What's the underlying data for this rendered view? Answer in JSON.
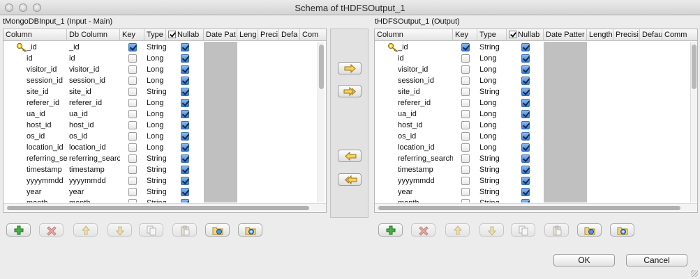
{
  "window": {
    "title": "Schema of tHDFSOutput_1"
  },
  "left": {
    "label": "tMongoDBInput_1 (Input - Main)",
    "headers": [
      "Column",
      "Db Column",
      "Key",
      "Type",
      "Nullab",
      "Date Pat",
      "Leng",
      "Preci",
      "Defa",
      "Com"
    ],
    "rows": [
      {
        "column": "_id",
        "db": "_id",
        "key": true,
        "type": "String",
        "nullable": true
      },
      {
        "column": "id",
        "db": "id",
        "key": false,
        "type": "Long",
        "nullable": true
      },
      {
        "column": "visitor_id",
        "db": "visitor_id",
        "key": false,
        "type": "Long",
        "nullable": true
      },
      {
        "column": "session_id",
        "db": "session_id",
        "key": false,
        "type": "Long",
        "nullable": true
      },
      {
        "column": "site_id",
        "db": "site_id",
        "key": false,
        "type": "String",
        "nullable": true
      },
      {
        "column": "referer_id",
        "db": "referer_id",
        "key": false,
        "type": "Long",
        "nullable": true
      },
      {
        "column": "ua_id",
        "db": "ua_id",
        "key": false,
        "type": "Long",
        "nullable": true
      },
      {
        "column": "host_id",
        "db": "host_id",
        "key": false,
        "type": "Long",
        "nullable": true
      },
      {
        "column": "os_id",
        "db": "os_id",
        "key": false,
        "type": "Long",
        "nullable": true
      },
      {
        "column": "location_id",
        "db": "location_id",
        "key": false,
        "type": "Long",
        "nullable": true
      },
      {
        "column": "referring_search",
        "db": "referring_search",
        "key": false,
        "type": "String",
        "nullable": true
      },
      {
        "column": "timestamp",
        "db": "timestamp",
        "key": false,
        "type": "String",
        "nullable": true
      },
      {
        "column": "yyyymmdd",
        "db": "yyyymmdd",
        "key": false,
        "type": "String",
        "nullable": true
      },
      {
        "column": "year",
        "db": "year",
        "key": false,
        "type": "String",
        "nullable": true
      },
      {
        "column": "month",
        "db": "month",
        "key": false,
        "type": "String",
        "nullable": true
      }
    ]
  },
  "right": {
    "label": "tHDFSOutput_1 (Output)",
    "headers": [
      "Column",
      "Key",
      "Type",
      "Nullab",
      "Date Patter",
      "Length",
      "Precisi",
      "Defau",
      "Comm"
    ],
    "rows": [
      {
        "column": "_id",
        "key": true,
        "type": "String",
        "nullable": true
      },
      {
        "column": "id",
        "key": false,
        "type": "Long",
        "nullable": true
      },
      {
        "column": "visitor_id",
        "key": false,
        "type": "Long",
        "nullable": true
      },
      {
        "column": "session_id",
        "key": false,
        "type": "Long",
        "nullable": true
      },
      {
        "column": "site_id",
        "key": false,
        "type": "String",
        "nullable": true
      },
      {
        "column": "referer_id",
        "key": false,
        "type": "Long",
        "nullable": true
      },
      {
        "column": "ua_id",
        "key": false,
        "type": "Long",
        "nullable": true
      },
      {
        "column": "host_id",
        "key": false,
        "type": "Long",
        "nullable": true
      },
      {
        "column": "os_id",
        "key": false,
        "type": "Long",
        "nullable": true
      },
      {
        "column": "location_id",
        "key": false,
        "type": "Long",
        "nullable": true
      },
      {
        "column": "referring_search",
        "key": false,
        "type": "String",
        "nullable": true
      },
      {
        "column": "timestamp",
        "key": false,
        "type": "String",
        "nullable": true
      },
      {
        "column": "yyyymmdd",
        "key": false,
        "type": "String",
        "nullable": true
      },
      {
        "column": "year",
        "key": false,
        "type": "String",
        "nullable": true
      },
      {
        "column": "month",
        "key": false,
        "type": "String",
        "nullable": true
      }
    ]
  },
  "transfer_buttons": [
    "copy-selected-right-icon",
    "copy-all-right-icon",
    "copy-selected-left-icon",
    "copy-all-left-icon"
  ],
  "toolbar_icons": [
    "add-icon",
    "remove-icon",
    "move-up-icon",
    "move-down-icon",
    "copy-icon",
    "paste-icon",
    "import-icon",
    "export-icon"
  ],
  "buttons": {
    "ok": "OK",
    "cancel": "Cancel"
  },
  "colors": {
    "check_blue": "#3979d3",
    "grey_column": "#c0c0c0",
    "add_green": "#2e9e2e",
    "remove_red": "#d04040"
  }
}
